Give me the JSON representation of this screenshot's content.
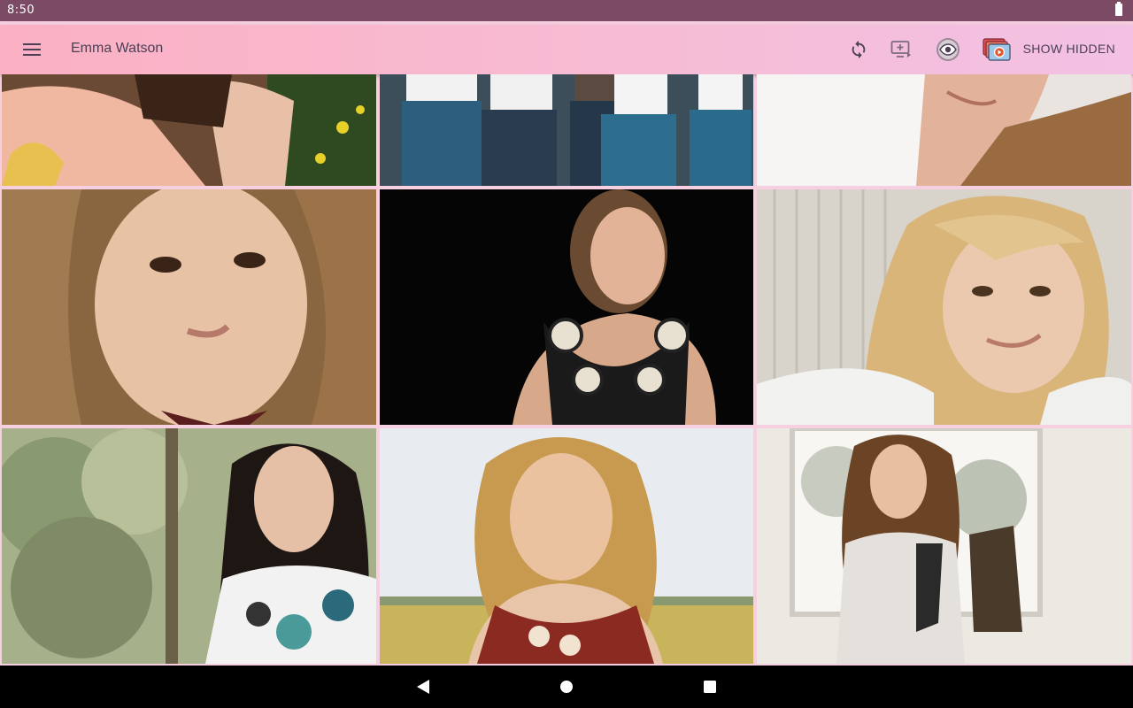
{
  "status_bar": {
    "time": "8:50",
    "battery_icon": "battery-full-icon"
  },
  "app_bar": {
    "menu_icon": "menu-icon",
    "title": "Emma Watson",
    "actions": [
      {
        "name": "refresh-button",
        "icon": "refresh-icon"
      },
      {
        "name": "slideshow-button",
        "icon": "add-to-screen-icon"
      },
      {
        "name": "hide-button",
        "icon": "eye-icon"
      },
      {
        "name": "video-button",
        "icon": "video-stack-icon"
      }
    ],
    "show_hidden_label": "SHOW HIDDEN"
  },
  "gallery": {
    "images": [
      {
        "row": 0,
        "col": 0,
        "subject": "girl in peach dress on yellow chair"
      },
      {
        "row": 0,
        "col": 1,
        "subject": "people in jeans and white tops"
      },
      {
        "row": 0,
        "col": 2,
        "subject": "woman lying on white pillows"
      },
      {
        "row": 1,
        "col": 0,
        "subject": "close-up portrait with wavy hair"
      },
      {
        "row": 1,
        "col": 1,
        "subject": "portrait on black background with embellished neckline"
      },
      {
        "row": 1,
        "col": 2,
        "subject": "blonde portrait smiling"
      },
      {
        "row": 2,
        "col": 0,
        "subject": "dark-haired woman in floral top outdoors"
      },
      {
        "row": 2,
        "col": 1,
        "subject": "girl with wavy hair in field"
      },
      {
        "row": 2,
        "col": 2,
        "subject": "girl sitting on chair by window"
      }
    ]
  },
  "nav_bar": {
    "back_icon": "back-triangle-icon",
    "home_icon": "home-circle-icon",
    "recents_icon": "recents-square-icon"
  },
  "colors": {
    "status_bar": "#7b4a64",
    "app_bar_start": "#fbb0c3",
    "app_bar_end": "#f2c1e4",
    "grid_gap": "#f6cfe0",
    "title_text": "#4a3f55"
  }
}
